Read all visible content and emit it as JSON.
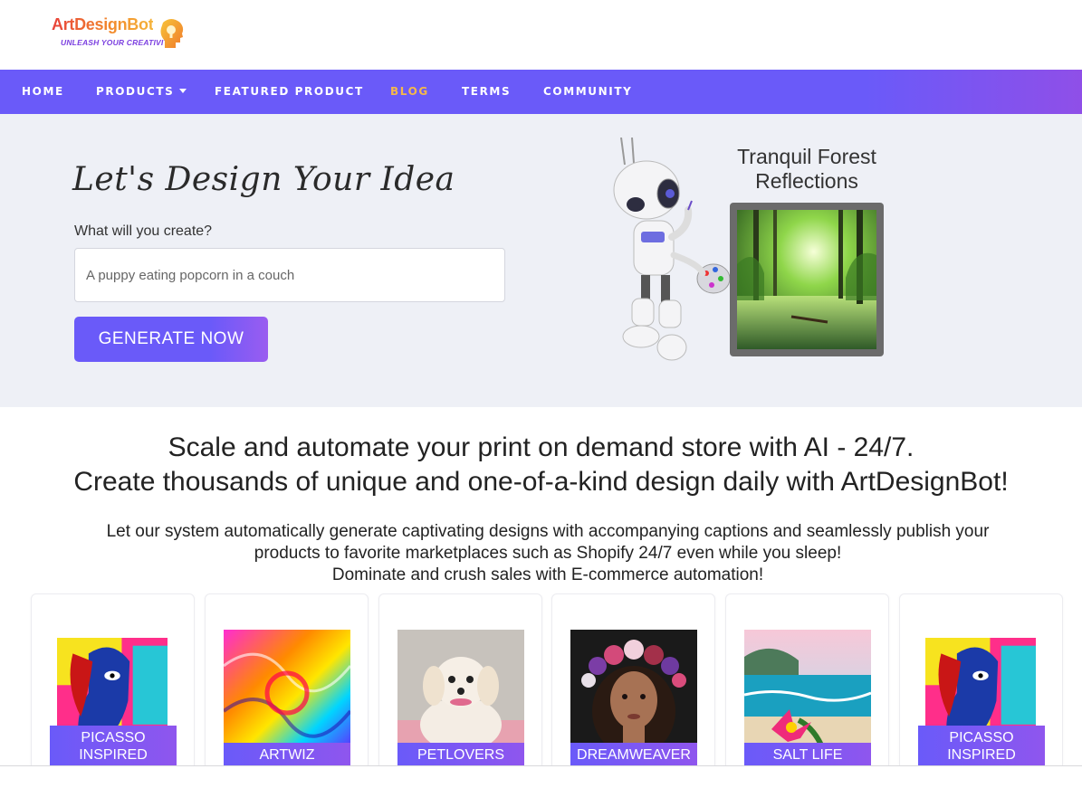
{
  "logo": {
    "name": "ArtDesignBot",
    "tagline": "UNLEASH YOUR CREATIVITY"
  },
  "nav": {
    "items": [
      {
        "label": "HOME",
        "active": false
      },
      {
        "label": "PRODUCTS",
        "active": false,
        "dropdown": true
      },
      {
        "label": "FEATURED PRODUCT",
        "active": false
      },
      {
        "label": "BLOG",
        "active": true
      },
      {
        "label": "TERMS",
        "active": false
      },
      {
        "label": "COMMUNITY",
        "active": false
      }
    ]
  },
  "hero": {
    "title": "Let's Design Your Idea",
    "prompt_label": "What will you create?",
    "prompt_placeholder": "A puppy eating popcorn in a couch",
    "button_label": "GENERATE NOW",
    "showcase_title": "Tranquil Forest Reflections"
  },
  "content": {
    "headline_1": "Scale and automate your print on demand store with AI - 24/7.",
    "headline_2": "Create thousands of unique and one-of-a-kind design daily with ArtDesignBot!",
    "para_1": "Let our system automatically generate captivating designs with accompanying captions and seamlessly publish your",
    "para_2": "products to favorite marketplaces such as Shopify 24/7 even while you sleep!",
    "para_3": "Dominate and crush sales with E-commerce automation!"
  },
  "cards": [
    {
      "label": "PICASSO INSPIRED"
    },
    {
      "label": "ARTWIZ"
    },
    {
      "label": "PETLOVERS"
    },
    {
      "label": "DREAMWEAVER"
    },
    {
      "label": "SALT LIFE"
    },
    {
      "label": "PICASSO INSPIRED"
    }
  ],
  "colors": {
    "accent": "#6a5af9",
    "active_nav": "#f5b84a",
    "hero_bg": "#eef0f6"
  }
}
